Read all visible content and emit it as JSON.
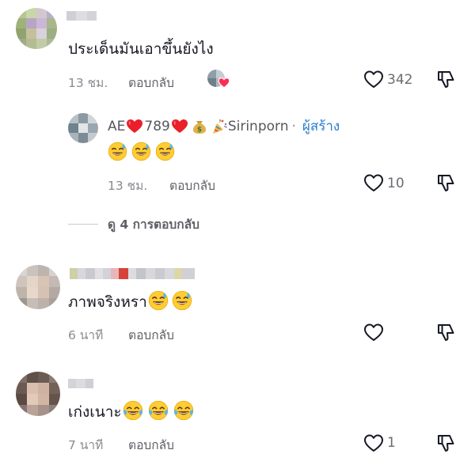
{
  "comments": [
    {
      "text": "ประเด็นมันเอาขึ้นยังไง",
      "time": "13 ชม.",
      "reply_label": "ตอบกลับ",
      "likes": "342"
    },
    {
      "text": "ภาพจริงหรา",
      "time": "6 นาที",
      "reply_label": "ตอบกลับ",
      "likes": ""
    },
    {
      "text": "เก่งเนาะ",
      "time": "7 นาที",
      "reply_label": "ตอบกลับ",
      "likes": "1"
    }
  ],
  "reply": {
    "username_prefix": "AE",
    "username_mid": "789",
    "username_suffix": "Sirinporn",
    "separator": "·",
    "creator_badge": "ผู้สร้าง",
    "time": "13 ชม.",
    "reply_label": "ตอบกลับ",
    "likes": "10"
  },
  "view_replies": "ดู 4 การตอบกลับ",
  "icons": {
    "like": "heart-outline-icon",
    "dislike": "thumbs-down-outline-icon",
    "creator_liked": "creator-liked-heart-icon"
  },
  "colors": {
    "creator_blue": "#2a7dd1",
    "heart_red": "#fe2c55",
    "meta_gray": "#8a8b91"
  }
}
